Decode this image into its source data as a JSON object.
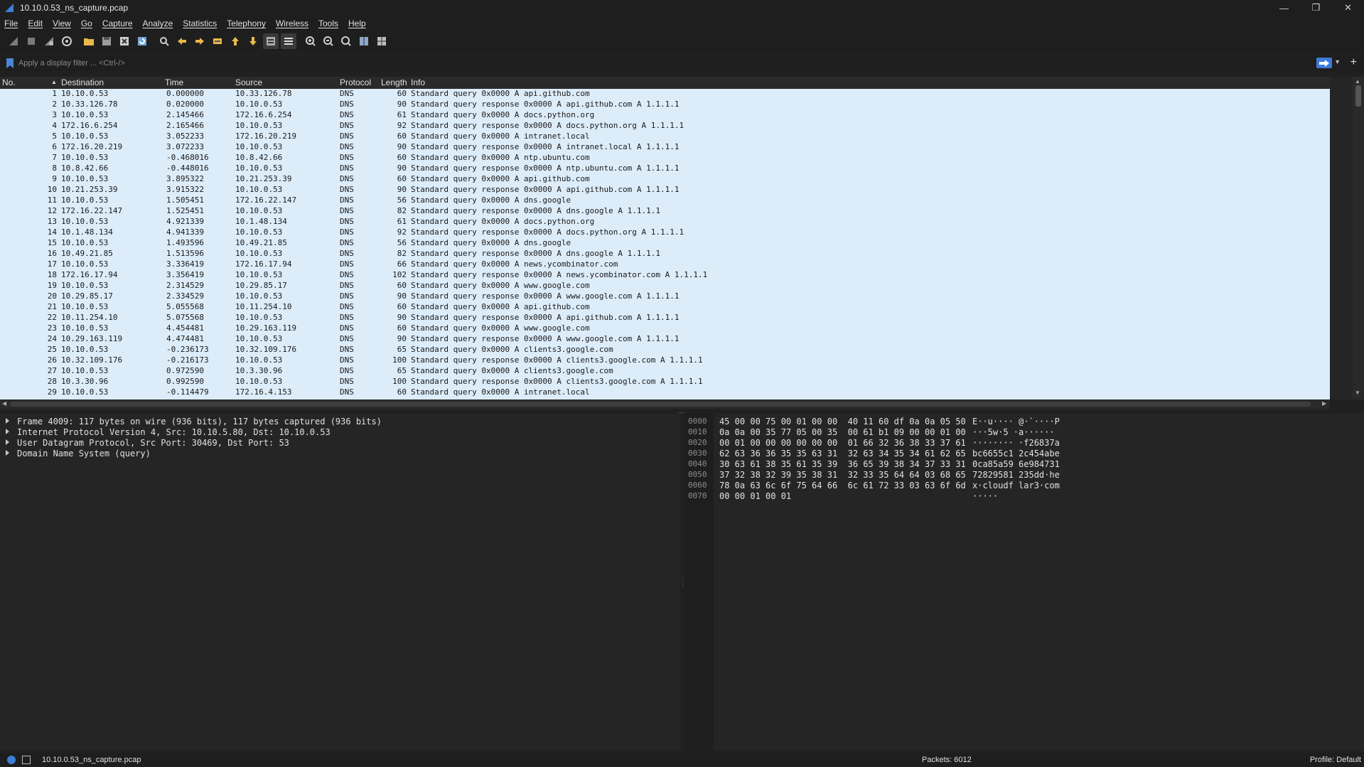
{
  "window": {
    "title": "10.10.0.53_ns_capture.pcap"
  },
  "menu": [
    "File",
    "Edit",
    "View",
    "Go",
    "Capture",
    "Analyze",
    "Statistics",
    "Telephony",
    "Wireless",
    "Tools",
    "Help"
  ],
  "filter": {
    "placeholder": "Apply a display filter ... <Ctrl-/>"
  },
  "packet_list": {
    "columns": {
      "no": "No.",
      "destination": "Destination",
      "time": "Time",
      "source": "Source",
      "protocol": "Protocol",
      "length": "Length",
      "info": "Info"
    },
    "rows": [
      [
        "1",
        "10.10.0.53",
        "0.000000",
        "10.33.126.78",
        "DNS",
        "60",
        "Standard query 0x0000 A api.github.com"
      ],
      [
        "2",
        "10.33.126.78",
        "0.020000",
        "10.10.0.53",
        "DNS",
        "90",
        "Standard query response 0x0000 A api.github.com A 1.1.1.1"
      ],
      [
        "3",
        "10.10.0.53",
        "2.145466",
        "172.16.6.254",
        "DNS",
        "61",
        "Standard query 0x0000 A docs.python.org"
      ],
      [
        "4",
        "172.16.6.254",
        "2.165466",
        "10.10.0.53",
        "DNS",
        "92",
        "Standard query response 0x0000 A docs.python.org A 1.1.1.1"
      ],
      [
        "5",
        "10.10.0.53",
        "3.052233",
        "172.16.20.219",
        "DNS",
        "60",
        "Standard query 0x0000 A intranet.local"
      ],
      [
        "6",
        "172.16.20.219",
        "3.072233",
        "10.10.0.53",
        "DNS",
        "90",
        "Standard query response 0x0000 A intranet.local A 1.1.1.1"
      ],
      [
        "7",
        "10.10.0.53",
        "-0.468016",
        "10.8.42.66",
        "DNS",
        "60",
        "Standard query 0x0000 A ntp.ubuntu.com"
      ],
      [
        "8",
        "10.8.42.66",
        "-0.448016",
        "10.10.0.53",
        "DNS",
        "90",
        "Standard query response 0x0000 A ntp.ubuntu.com A 1.1.1.1"
      ],
      [
        "9",
        "10.10.0.53",
        "3.895322",
        "10.21.253.39",
        "DNS",
        "60",
        "Standard query 0x0000 A api.github.com"
      ],
      [
        "10",
        "10.21.253.39",
        "3.915322",
        "10.10.0.53",
        "DNS",
        "90",
        "Standard query response 0x0000 A api.github.com A 1.1.1.1"
      ],
      [
        "11",
        "10.10.0.53",
        "1.505451",
        "172.16.22.147",
        "DNS",
        "56",
        "Standard query 0x0000 A dns.google"
      ],
      [
        "12",
        "172.16.22.147",
        "1.525451",
        "10.10.0.53",
        "DNS",
        "82",
        "Standard query response 0x0000 A dns.google A 1.1.1.1"
      ],
      [
        "13",
        "10.10.0.53",
        "4.921339",
        "10.1.48.134",
        "DNS",
        "61",
        "Standard query 0x0000 A docs.python.org"
      ],
      [
        "14",
        "10.1.48.134",
        "4.941339",
        "10.10.0.53",
        "DNS",
        "92",
        "Standard query response 0x0000 A docs.python.org A 1.1.1.1"
      ],
      [
        "15",
        "10.10.0.53",
        "1.493596",
        "10.49.21.85",
        "DNS",
        "56",
        "Standard query 0x0000 A dns.google"
      ],
      [
        "16",
        "10.49.21.85",
        "1.513596",
        "10.10.0.53",
        "DNS",
        "82",
        "Standard query response 0x0000 A dns.google A 1.1.1.1"
      ],
      [
        "17",
        "10.10.0.53",
        "3.336419",
        "172.16.17.94",
        "DNS",
        "66",
        "Standard query 0x0000 A news.ycombinator.com"
      ],
      [
        "18",
        "172.16.17.94",
        "3.356419",
        "10.10.0.53",
        "DNS",
        "102",
        "Standard query response 0x0000 A news.ycombinator.com A 1.1.1.1"
      ],
      [
        "19",
        "10.10.0.53",
        "2.314529",
        "10.29.85.17",
        "DNS",
        "60",
        "Standard query 0x0000 A www.google.com"
      ],
      [
        "20",
        "10.29.85.17",
        "2.334529",
        "10.10.0.53",
        "DNS",
        "90",
        "Standard query response 0x0000 A www.google.com A 1.1.1.1"
      ],
      [
        "21",
        "10.10.0.53",
        "5.055568",
        "10.11.254.10",
        "DNS",
        "60",
        "Standard query 0x0000 A api.github.com"
      ],
      [
        "22",
        "10.11.254.10",
        "5.075568",
        "10.10.0.53",
        "DNS",
        "90",
        "Standard query response 0x0000 A api.github.com A 1.1.1.1"
      ],
      [
        "23",
        "10.10.0.53",
        "4.454481",
        "10.29.163.119",
        "DNS",
        "60",
        "Standard query 0x0000 A www.google.com"
      ],
      [
        "24",
        "10.29.163.119",
        "4.474481",
        "10.10.0.53",
        "DNS",
        "90",
        "Standard query response 0x0000 A www.google.com A 1.1.1.1"
      ],
      [
        "25",
        "10.10.0.53",
        "-0.236173",
        "10.32.109.176",
        "DNS",
        "65",
        "Standard query 0x0000 A clients3.google.com"
      ],
      [
        "26",
        "10.32.109.176",
        "-0.216173",
        "10.10.0.53",
        "DNS",
        "100",
        "Standard query response 0x0000 A clients3.google.com A 1.1.1.1"
      ],
      [
        "27",
        "10.10.0.53",
        "0.972590",
        "10.3.30.96",
        "DNS",
        "65",
        "Standard query 0x0000 A clients3.google.com"
      ],
      [
        "28",
        "10.3.30.96",
        "0.992590",
        "10.10.0.53",
        "DNS",
        "100",
        "Standard query response 0x0000 A clients3.google.com A 1.1.1.1"
      ],
      [
        "29",
        "10.10.0.53",
        "-0.114479",
        "172.16.4.153",
        "DNS",
        "60",
        "Standard query 0x0000 A intranet.local"
      ]
    ]
  },
  "details": [
    "Frame 4009: 117 bytes on wire (936 bits), 117 bytes captured (936 bits)",
    "Internet Protocol Version 4, Src: 10.10.5.80, Dst: 10.10.0.53",
    "User Datagram Protocol, Src Port: 30469, Dst Port: 53",
    "Domain Name System (query)"
  ],
  "bytes": [
    [
      "0000",
      "45 00 00 75 00 01 00 00  40 11 60 df 0a 0a 05 50",
      "E··u···· @·`····P"
    ],
    [
      "0010",
      "0a 0a 00 35 77 05 00 35  00 61 b1 09 00 00 01 00",
      "···5w·5 ·a······"
    ],
    [
      "0020",
      "00 01 00 00 00 00 00 00  01 66 32 36 38 33 37 61",
      "········ ·f26837a"
    ],
    [
      "0030",
      "62 63 36 36 35 35 63 31  32 63 34 35 34 61 62 65",
      "bc6655c1 2c454abe"
    ],
    [
      "0040",
      "30 63 61 38 35 61 35 39  36 65 39 38 34 37 33 31",
      "0ca85a59 6e984731"
    ],
    [
      "0050",
      "37 32 38 32 39 35 38 31  32 33 35 64 64 03 68 65",
      "72829581 235dd·he"
    ],
    [
      "0060",
      "78 0a 63 6c 6f 75 64 66  6c 61 72 33 03 63 6f 6d",
      "x·cloudf lar3·com"
    ],
    [
      "0070",
      "00 00 01 00 01",
      "·····"
    ]
  ],
  "status": {
    "file": "10.10.0.53_ns_capture.pcap",
    "packets": "Packets: 6012",
    "profile": "Profile: Default"
  },
  "colors": {
    "row_bg": "#dcecf9",
    "accent": "#3c7ad6",
    "pane_bg": "#252525"
  }
}
